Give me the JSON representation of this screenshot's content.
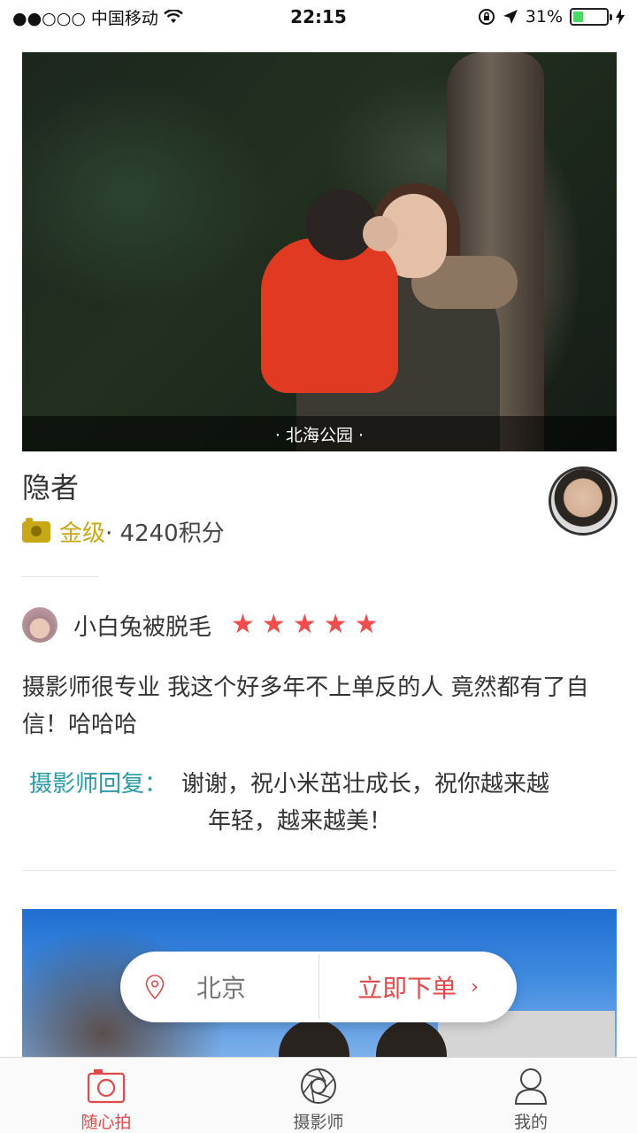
{
  "status_bar": {
    "carrier": "●●○○○ 中国移动",
    "time": "22:15",
    "battery": "31%",
    "battery_level": 0.31
  },
  "photo1": {
    "location": "· 北海公园 ·"
  },
  "photographer": {
    "name": "隐者",
    "level": "金级",
    "points": " · 4240积分"
  },
  "review": {
    "reviewer_name": "小白兔被脱毛",
    "stars": 5,
    "text": "摄影师很专业 我这个好多年不上单反的人 竟然都有了自信！哈哈哈",
    "reply_label": "摄影师回复：",
    "reply_line1": "谢谢，祝小米茁壮成长，祝你越来越",
    "reply_line2": "年轻，越来越美！"
  },
  "order_bar": {
    "city": "北京",
    "order_label": "立即下单",
    "chevron": "›"
  },
  "tabs": [
    {
      "label": "随心拍",
      "icon": "camera-icon",
      "active": true
    },
    {
      "label": "摄影师",
      "icon": "aperture-icon",
      "active": false
    },
    {
      "label": "我的",
      "icon": "user-icon",
      "active": false
    }
  ],
  "colors": {
    "accent": "#e04a4a",
    "gold": "#c9a817",
    "reply": "#2a9aa6",
    "star": "#f24c4c"
  }
}
